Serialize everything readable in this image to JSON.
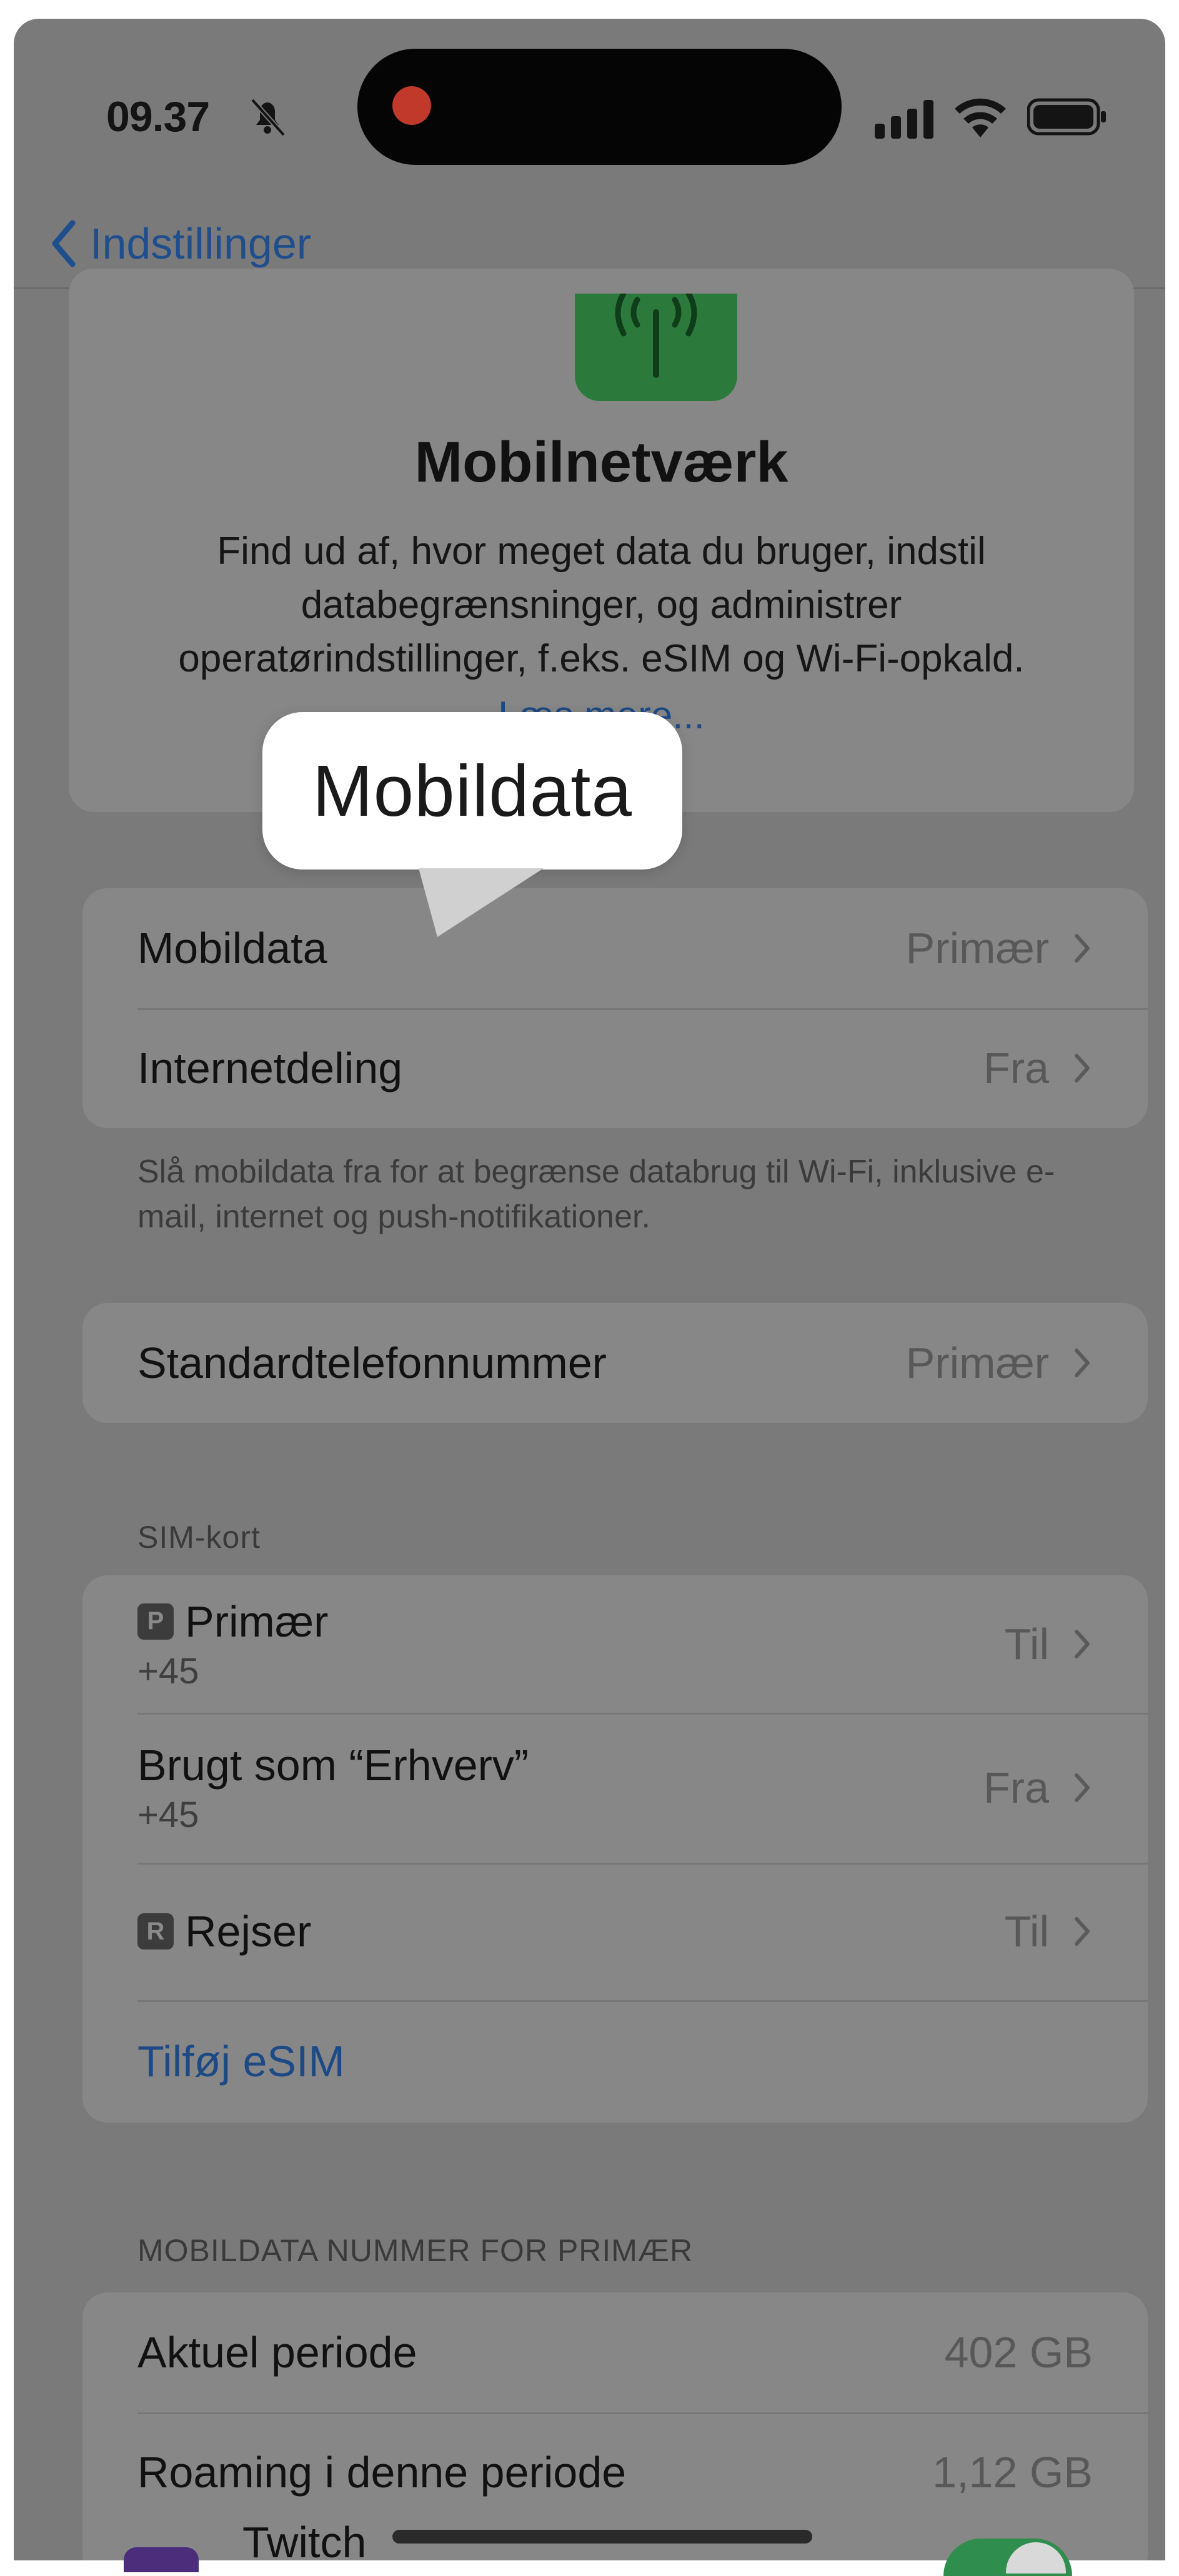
{
  "status_bar": {
    "time": "09.37"
  },
  "nav": {
    "back_label": "Indstillinger"
  },
  "header": {
    "title": "Mobilnetværk",
    "description": "Find ud af, hvor meget data du bruger, indstil databegrænsninger, og administrer operatørindstillinger, f.eks. eSIM og Wi-Fi-opkald.",
    "link": "Læs mere..."
  },
  "tooltip": {
    "label": "Mobildata"
  },
  "data_group": {
    "rows": [
      {
        "label": "Mobildata",
        "value": "Primær"
      },
      {
        "label": "Internetdeling",
        "value": "Fra"
      }
    ],
    "footnote": "Slå mobildata fra for at begrænse databrug til Wi-Fi, inklusive e-mail, internet og push-notifikationer."
  },
  "default_number": {
    "label": "Standardtelefonnummer",
    "value": "Primær"
  },
  "sim": {
    "title": "SIM-kort",
    "rows": [
      {
        "badge": "P",
        "name": "Primær",
        "number": "+45",
        "value": "Til"
      },
      {
        "name": "Brugt som “Erhverv”",
        "number": "+45",
        "value": "Fra"
      },
      {
        "badge": "R",
        "name": "Rejser",
        "value": "Til"
      }
    ],
    "add_esim": "Tilføj eSIM"
  },
  "usage": {
    "title": "MOBILDATA NUMMER FOR PRIMÆR",
    "rows": [
      {
        "label": "Aktuel periode",
        "value": "402 GB"
      },
      {
        "label": "Roaming i denne periode",
        "value": "1,12 GB"
      }
    ],
    "app_row": {
      "label": "Twitch",
      "enabled": true
    }
  },
  "colors": {
    "accent": "#1d4a85",
    "toggle_on": "#2f8d4e",
    "recording": "#c0392b",
    "app_icon": "#2b7a3b"
  }
}
